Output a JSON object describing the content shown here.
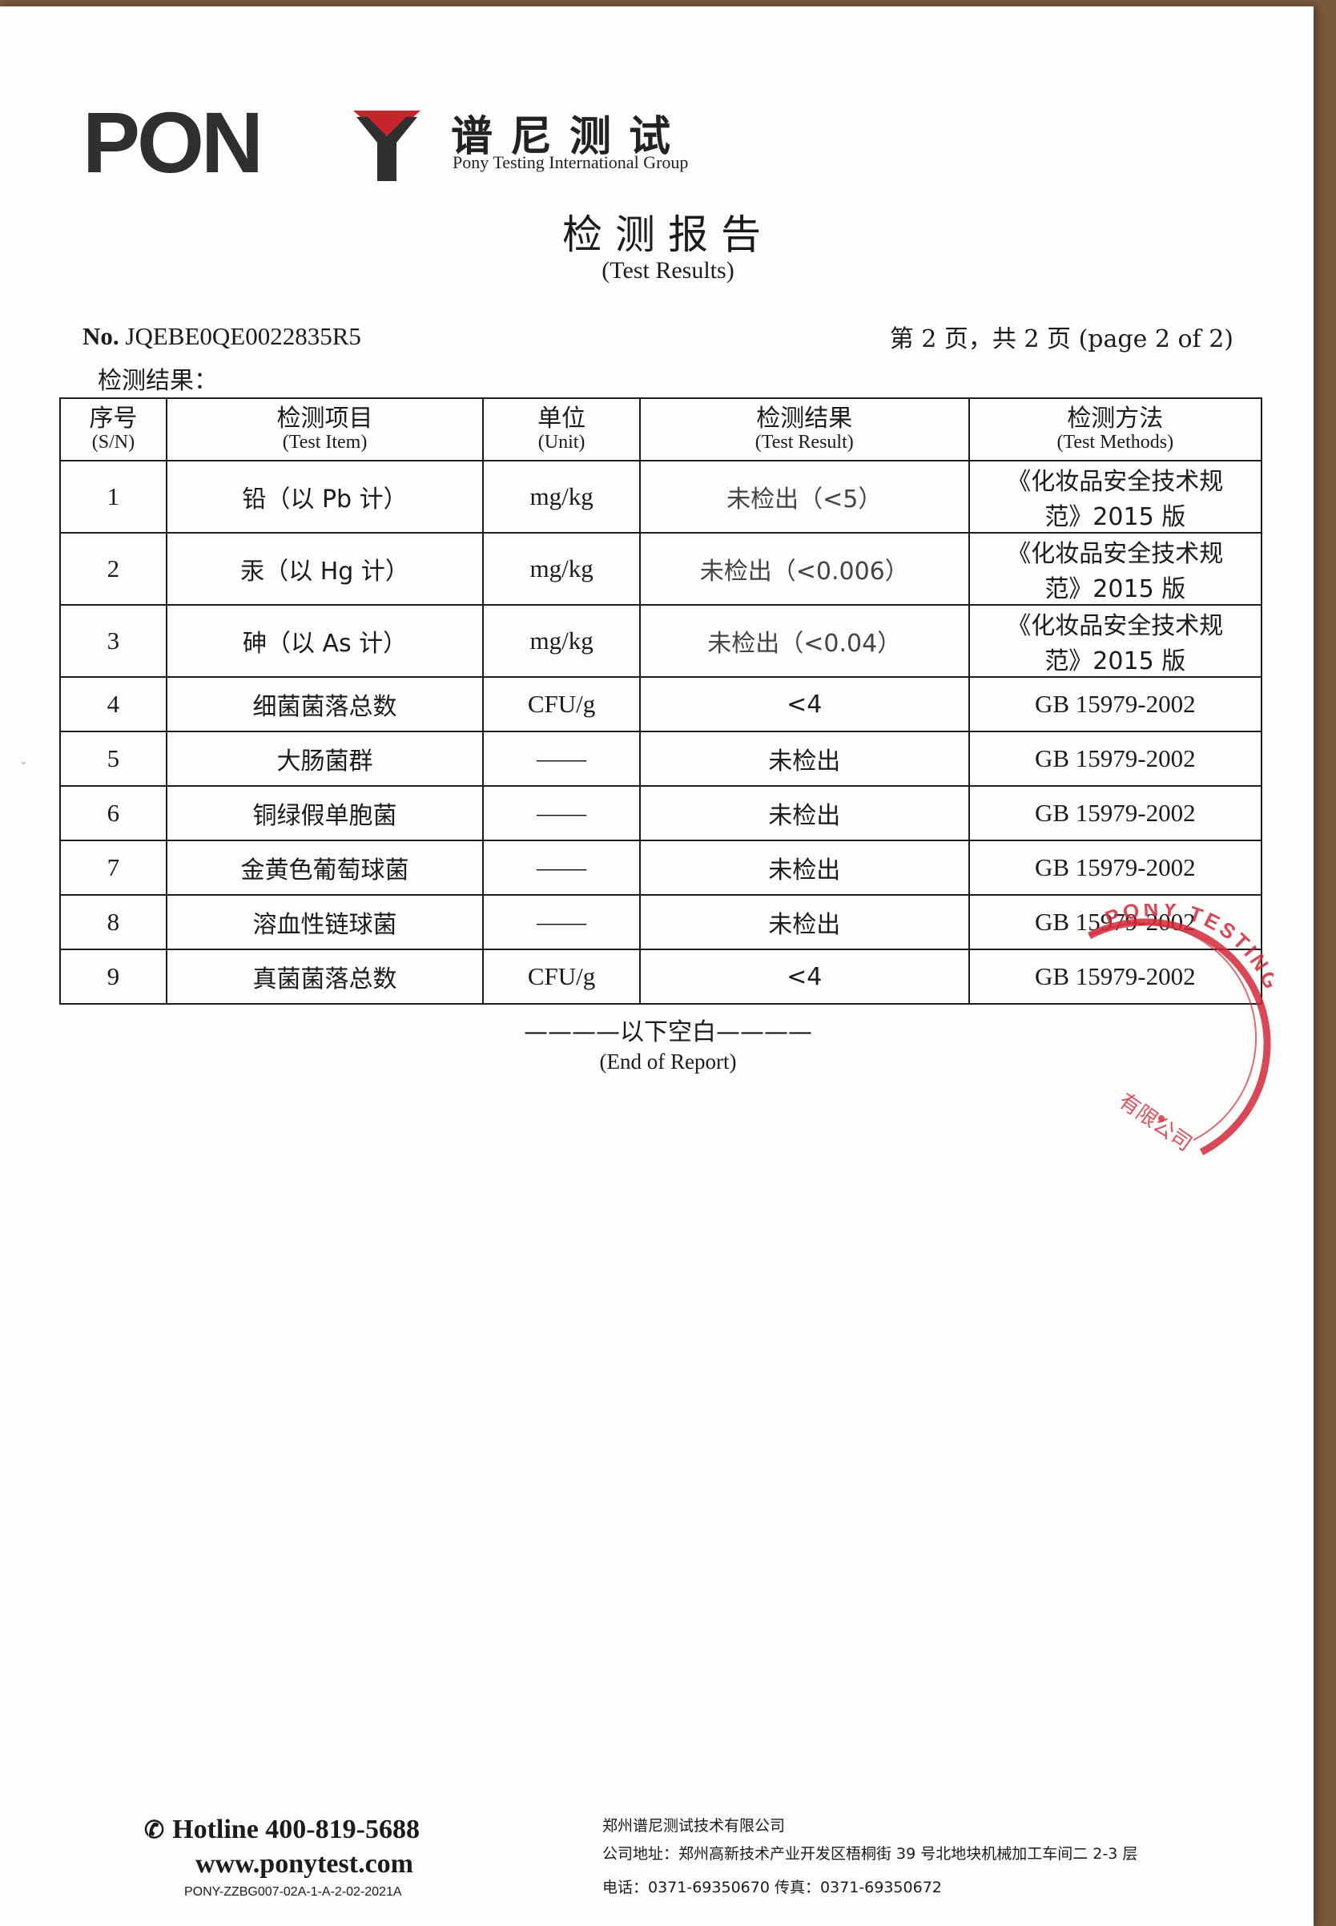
{
  "header": {
    "logo_word": "PONY",
    "logo_cn": "谱尼测试",
    "logo_en": "Pony Testing International Group"
  },
  "title": {
    "cn": "检测报告",
    "en": "(Test Results)"
  },
  "report": {
    "no_label": "No.",
    "no_value": "JQEBE0QE0022835R5",
    "page_info": "第 2 页，共 2 页 (page 2 of 2)",
    "section_label": "检测结果："
  },
  "table": {
    "headers": [
      {
        "cn": "序号",
        "en": "(S/N)"
      },
      {
        "cn": "检测项目",
        "en": "(Test Item)"
      },
      {
        "cn": "单位",
        "en": "(Unit)"
      },
      {
        "cn": "检测结果",
        "en": "(Test Result)"
      },
      {
        "cn": "检测方法",
        "en": "(Test Methods)"
      }
    ],
    "rows": [
      {
        "sn": "1",
        "item": "铅（以 Pb 计）",
        "unit": "mg/kg",
        "result": "未检出（<5）",
        "method_line1": "《化妆品安全技术规",
        "method_line2": "范》2015 版"
      },
      {
        "sn": "2",
        "item": "汞（以 Hg 计）",
        "unit": "mg/kg",
        "result": "未检出（<0.006）",
        "method_line1": "《化妆品安全技术规",
        "method_line2": "范》2015 版"
      },
      {
        "sn": "3",
        "item": "砷（以 As 计）",
        "unit": "mg/kg",
        "result": "未检出（<0.04）",
        "method_line1": "《化妆品安全技术规",
        "method_line2": "范》2015 版"
      },
      {
        "sn": "4",
        "item": "细菌菌落总数",
        "unit": "CFU/g",
        "result": "<4",
        "method": "GB 15979-2002"
      },
      {
        "sn": "5",
        "item": "大肠菌群",
        "unit": "——",
        "result": "未检出",
        "method": "GB 15979-2002"
      },
      {
        "sn": "6",
        "item": "铜绿假单胞菌",
        "unit": "——",
        "result": "未检出",
        "method": "GB 15979-2002"
      },
      {
        "sn": "7",
        "item": "金黄色葡萄球菌",
        "unit": "——",
        "result": "未检出",
        "method": "GB 15979-2002"
      },
      {
        "sn": "8",
        "item": "溶血性链球菌",
        "unit": "——",
        "result": "未检出",
        "method": "GB 15979-2002"
      },
      {
        "sn": "9",
        "item": "真菌菌落总数",
        "unit": "CFU/g",
        "result": "<4",
        "method": "GB 15979-2002"
      }
    ]
  },
  "end": {
    "cn": "————以下空白————",
    "en": "(End of Report)"
  },
  "seal": {
    "text_outer": "PONY TESTING",
    "text_inner": "有限公司",
    "color": "#d2283a"
  },
  "footer": {
    "hotline": "Hotline 400-819-5688",
    "website": "www.ponytest.com",
    "form_code": "PONY-ZZBG007-02A-1-A-2-02-2021A",
    "company": "郑州谱尼测试技术有限公司",
    "address": "公司地址：郑州高新技术产业开发区梧桐街 39 号北地块机械加工车间二 2-3 层",
    "phone": "电话：0371-69350670   传真：0371-69350672"
  },
  "colors": {
    "logo_red": "#c8232c",
    "logo_gray": "#2f2f2f"
  }
}
